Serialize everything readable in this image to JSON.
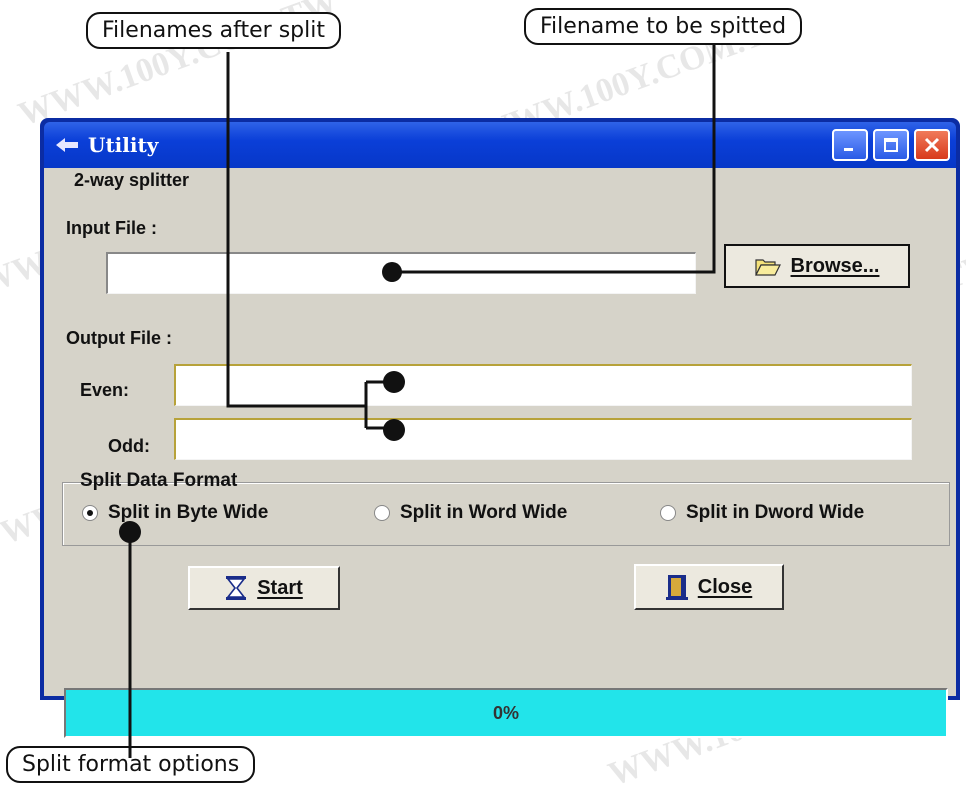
{
  "callouts": {
    "filenames_after_split": "Filenames after split",
    "filename_to_be_splitted": "Filename to be spitted",
    "split_format_options": "Split format options"
  },
  "window": {
    "title": "Utility",
    "title_icon": "app-arrow-icon",
    "controls": [
      "minimize-icon",
      "maximize-icon",
      "close-icon"
    ]
  },
  "dialog": {
    "group_title": "2-way splitter",
    "input_label": "Input File :",
    "input_value": "",
    "browse_label": "Browse...",
    "browse_icon": "folder-open-icon",
    "output_label": "Output File :",
    "even_label": "Even:",
    "even_value": "",
    "odd_label": "Odd:",
    "odd_value": "",
    "format_title": "Split Data Format",
    "format_options": [
      {
        "label": "Split in Byte Wide",
        "selected": true
      },
      {
        "label": "Split in Word Wide",
        "selected": false
      },
      {
        "label": "Split in Dword Wide",
        "selected": false
      }
    ],
    "start_label": "Start",
    "start_icon": "hourglass-icon",
    "close_label": "Close",
    "close_icon": "door-exit-icon",
    "progress_text": "0%",
    "progress_fraction": 0.0
  },
  "colors": {
    "window_frame": "#0b2ca3",
    "client_bg": "#d6d3c9",
    "progress_fill": "#22e4ea"
  },
  "watermark": "WWW.100Y.COM.TW"
}
